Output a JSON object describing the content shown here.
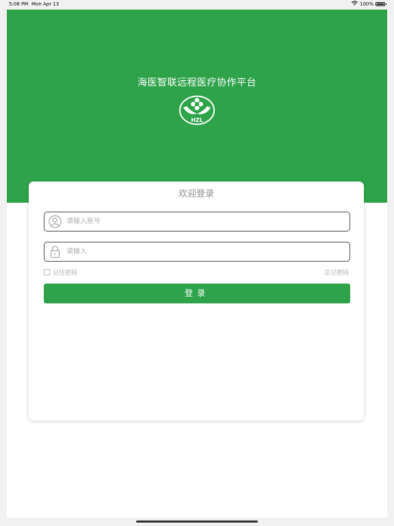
{
  "status_bar": {
    "time": "5:08 PM",
    "date": "Mon Apr 13",
    "battery_percent": "100%",
    "battery_level": 1.0,
    "icons": [
      "wifi-icon",
      "battery-icon"
    ]
  },
  "header": {
    "title": "海医智联远程医疗协作平台",
    "logo_text": "HZL",
    "background_color": "#2ea34a"
  },
  "login": {
    "title": "欢迎登录",
    "account_placeholder": "请输入账号",
    "account_value": "",
    "account_icon": "user-icon",
    "password_placeholder": "请输入",
    "password_value": "",
    "password_icon": "lock-icon",
    "remember_label": "记住密码",
    "remember_checked": false,
    "forgot_label": "忘记密码",
    "submit_label": "登录",
    "accent_color": "#2ea34a"
  }
}
